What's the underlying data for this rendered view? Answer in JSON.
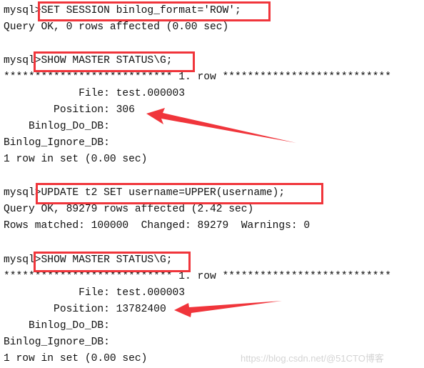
{
  "terminal": {
    "prompt": "mysql",
    "blocks": [
      {
        "command": ">SET SESSION binlog_format='ROW';",
        "output": [
          "Query OK, 0 rows affected (0.00 sec)"
        ]
      },
      {
        "command": ">SHOW MASTER STATUS\\G;",
        "output": [
          "*************************** 1. row ***************************",
          "            File: test.000003",
          "        Position: 306",
          "    Binlog_Do_DB: ",
          "Binlog_Ignore_DB: ",
          "1 row in set (0.00 sec)"
        ]
      },
      {
        "command": ">UPDATE t2 SET username=UPPER(username);",
        "output": [
          "Query OK, 89279 rows affected (2.42 sec)",
          "Rows matched: 100000  Changed: 89279  Warnings: 0"
        ]
      },
      {
        "command": ">SHOW MASTER STATUS\\G;",
        "output": [
          "*************************** 1. row ***************************",
          "            File: test.000003",
          "        Position: 13782400",
          "    Binlog_Do_DB: ",
          "Binlog_Ignore_DB: ",
          "1 row in set (0.00 sec)"
        ]
      }
    ]
  },
  "annotations": {
    "highlight_color": "#f0353b",
    "arrow_color": "#f0353b",
    "arrow_targets": [
      "Position: 306",
      "Position: 13782400"
    ]
  },
  "watermark": "https://blog.csdn.net/@51CTO博客"
}
